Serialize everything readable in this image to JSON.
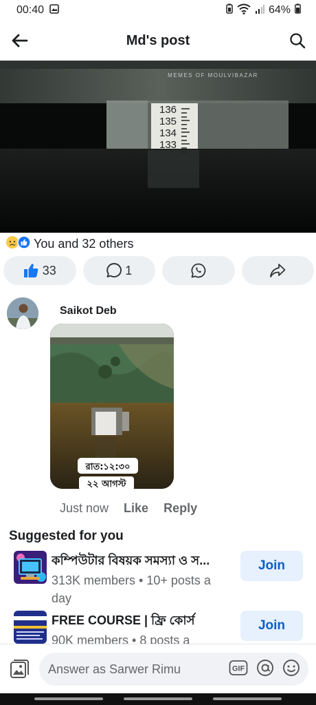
{
  "status_bar": {
    "time": "00:40",
    "battery": "64%"
  },
  "header": {
    "title": "Md's post"
  },
  "post": {
    "image_watermark": "MEMES OF MOULVIBAZAR",
    "gauge_marks": [
      "136",
      "135",
      "134",
      "133"
    ]
  },
  "reactions": {
    "text": "You and 32 others"
  },
  "actions": {
    "like_count": "33",
    "comment_count": "1"
  },
  "comment": {
    "author": "Saikot Deb",
    "photo_caption_line1": "রাত:১২:৩০",
    "photo_caption_line2": "২২ আগস্ট",
    "time": "Just now",
    "like_label": "Like",
    "reply_label": "Reply"
  },
  "suggested": {
    "title": "Suggested for you",
    "groups": [
      {
        "name": "কম্পিউটার বিষয়ক সমস্যা ও স...",
        "meta": "313K members • 10+ posts a day",
        "join_label": "Join"
      },
      {
        "name": "FREE COURSE | ফ্রি কোর্স",
        "meta": "90K members • 8 posts a",
        "join_label": "Join"
      }
    ]
  },
  "composer": {
    "placeholder": "Answer as Sarwer Rimu",
    "gif_label": "GIF"
  },
  "colors": {
    "accent": "#0a5fc9",
    "like_blue": "#1877f2",
    "pill_bg": "#edf0f3"
  }
}
